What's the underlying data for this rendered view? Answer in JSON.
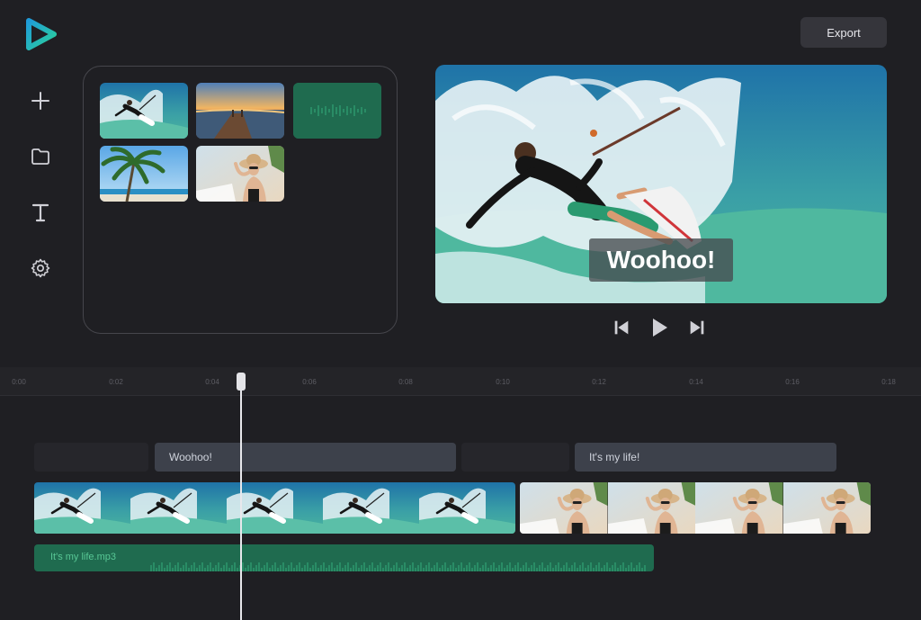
{
  "app": {
    "logo_icon": "play-triangle-logo",
    "export_label": "Export"
  },
  "sidebar": {
    "tools": [
      {
        "name": "add",
        "icon": "plus-icon"
      },
      {
        "name": "media",
        "icon": "folder-icon"
      },
      {
        "name": "text",
        "icon": "text-icon"
      },
      {
        "name": "settings",
        "icon": "gear-icon"
      }
    ]
  },
  "media_library": {
    "items": [
      {
        "type": "video",
        "subject": "kitesurfer"
      },
      {
        "type": "image",
        "subject": "pier-sunset"
      },
      {
        "type": "audio",
        "subject": "waveform"
      },
      {
        "type": "image",
        "subject": "palm-tree-beach"
      },
      {
        "type": "image",
        "subject": "woman-with-hat"
      }
    ]
  },
  "preview": {
    "caption": "Woohoo!"
  },
  "playback": {
    "prev_icon": "skip-back-icon",
    "play_icon": "play-icon",
    "next_icon": "skip-forward-icon"
  },
  "timeline": {
    "ticks": [
      "0:00",
      "0:02",
      "0:04",
      "0:06",
      "0:08",
      "0:10",
      "0:12",
      "0:14",
      "0:16",
      "0:18"
    ],
    "text_clips": [
      {
        "label": "Woohoo!"
      },
      {
        "label": "It's my life!"
      }
    ],
    "video_clips": [
      {
        "subject": "kitesurfer",
        "frames": 5
      },
      {
        "subject": "woman-with-hat",
        "frames": 4
      }
    ],
    "audio_clip": {
      "label": "It's my life.mp3"
    }
  },
  "colors": {
    "background": "#1f1f23",
    "accent_green": "#1f6b4f",
    "text_clip": "#3d414b",
    "logo_blue": "#1f9bd8",
    "logo_green": "#2bd19b"
  }
}
